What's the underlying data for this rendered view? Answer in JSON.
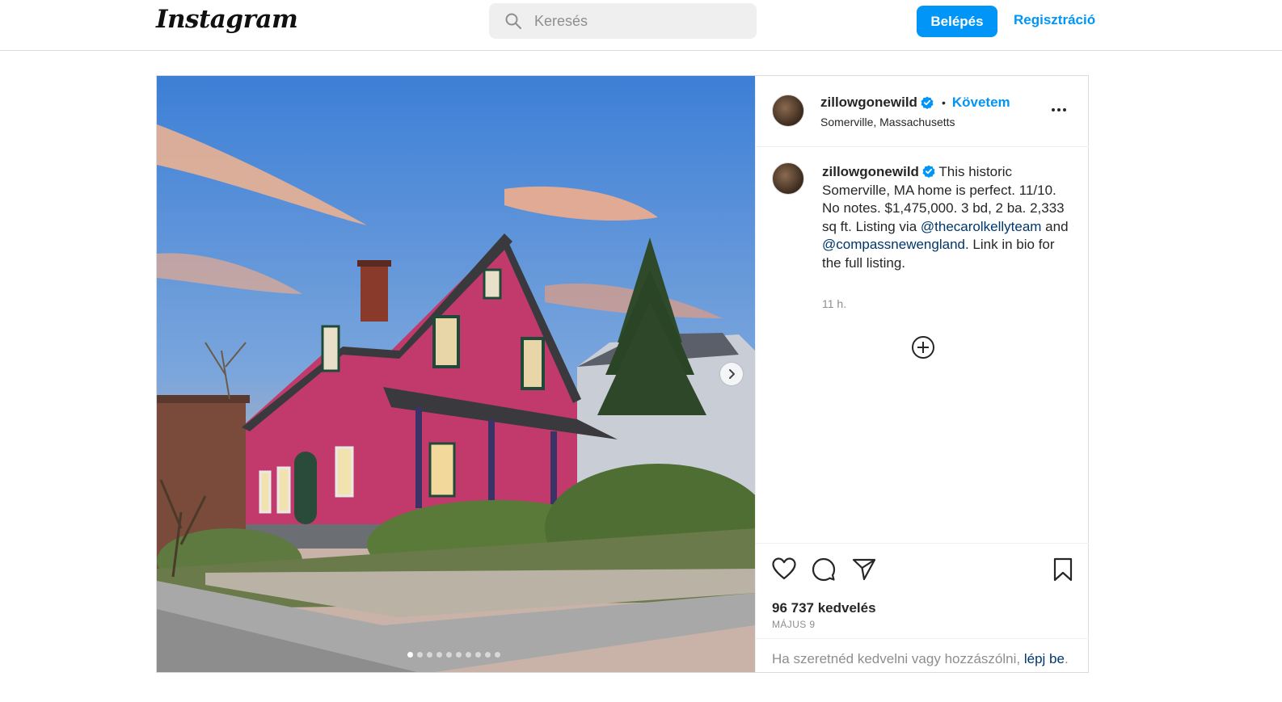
{
  "nav": {
    "logo": "Instagram",
    "search_placeholder": "Keresés",
    "login_label": "Belépés",
    "signup_label": "Regisztráció"
  },
  "post": {
    "username": "zillowgonewild",
    "follow_label": "Követem",
    "separator": "•",
    "location": "Somerville, Massachusetts",
    "caption": {
      "text_1": "This historic Somerville, MA home is perfect. 11/10. No notes. $1,475,000. 3 bd, 2 ba. 2,333 sq ft. Listing via ",
      "mention_1": "@thecarolkellyteam",
      "text_2": " and ",
      "mention_2": "@compassnewengland",
      "text_3": ". Link in bio for the full listing."
    },
    "time_ago": "11 h.",
    "likes": "96 737 kedvelés",
    "date": "MÁJUS 9",
    "login_prompt_text": "Ha szeretnéd kedvelni vagy hozzászólni, ",
    "login_prompt_link": "lépj be",
    "login_prompt_end": ".",
    "carousel": {
      "total": 10,
      "active_index": 0
    }
  },
  "icons": {
    "search": "search-icon",
    "verified": "verified-badge-icon",
    "more": "more-options-icon",
    "next": "chevron-right-icon",
    "add": "plus-circle-icon",
    "like": "heart-icon",
    "comment": "comment-icon",
    "share": "paper-plane-icon",
    "save": "bookmark-icon"
  },
  "colors": {
    "accent": "#0095f6",
    "link": "#00376b",
    "muted": "#8e8e8e",
    "border": "#dbdbdb"
  }
}
